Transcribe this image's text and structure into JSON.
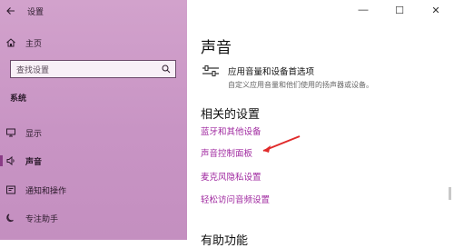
{
  "window": {
    "app_title": "设置",
    "controls": {
      "minimize": "—",
      "maximize": "☐",
      "close": "✕"
    }
  },
  "sidebar": {
    "home_label": "主页",
    "search_placeholder": "查找设置",
    "section_label": "系统",
    "items": [
      {
        "label": "显示",
        "icon": "monitor-icon"
      },
      {
        "label": "声音",
        "icon": "speaker-icon",
        "active": true
      },
      {
        "label": "通知和操作",
        "icon": "notification-icon"
      },
      {
        "label": "专注助手",
        "icon": "moon-icon"
      }
    ],
    "accent": "#8a3b86"
  },
  "main": {
    "title": "声音",
    "option": {
      "title": "应用音量和设备首选项",
      "description": "自定义应用音量和他们使用的扬声器或设备。",
      "icon": "sliders-icon"
    },
    "related_title": "相关的设置",
    "links": [
      "蓝牙和其他设备",
      "声音控制面板",
      "麦克风隐私设置",
      "轻松访问音频设置"
    ],
    "next_section_partial": "有助功能",
    "link_color": "#a02aa0",
    "arrow_color": "#e02a2a"
  }
}
